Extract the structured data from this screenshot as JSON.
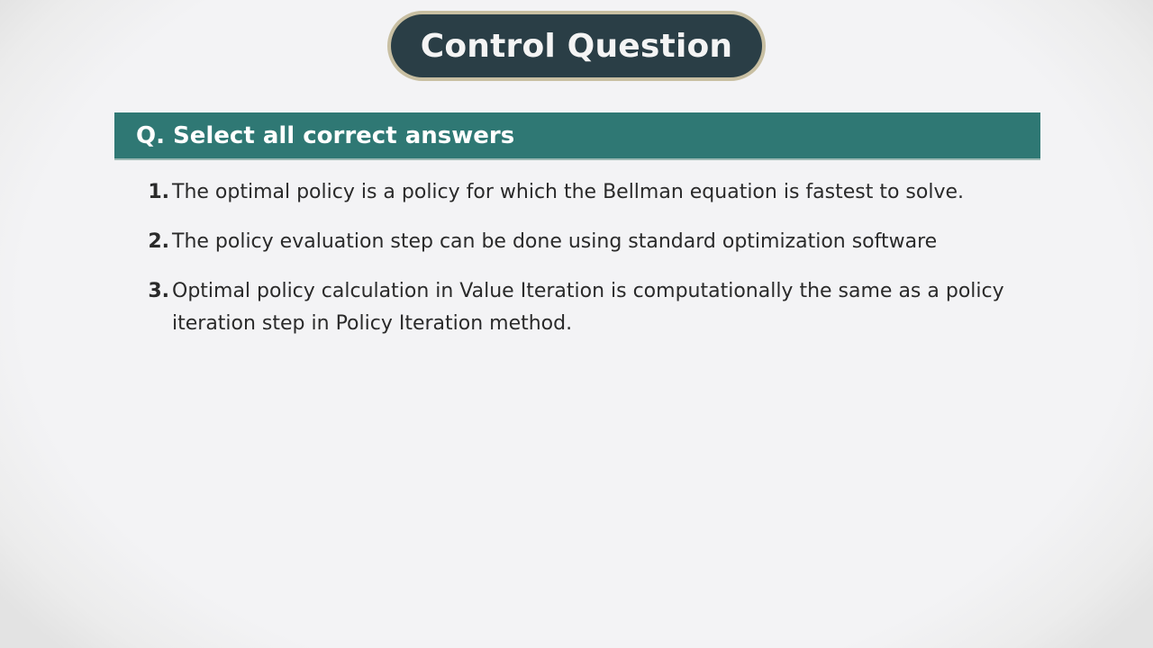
{
  "slide": {
    "title": "Control Question",
    "question": "Q. Select all correct answers",
    "answers": [
      {
        "number": "1.",
        "text": "The optimal policy is a policy for which the Bellman equation is fastest to solve."
      },
      {
        "number": "2.",
        "text": "The policy evaluation step can be done using standard optimization software"
      },
      {
        "number": "3.",
        "text": "Optimal policy calculation in Value Iteration is computationally the same as a policy iteration step in Policy Iteration method."
      }
    ]
  },
  "colors": {
    "title_fill": "#2a3e46",
    "title_border": "#c8bfa2",
    "question_bar": "#2f7874",
    "background": "#f3f3f5",
    "text": "#2a2a2a"
  }
}
